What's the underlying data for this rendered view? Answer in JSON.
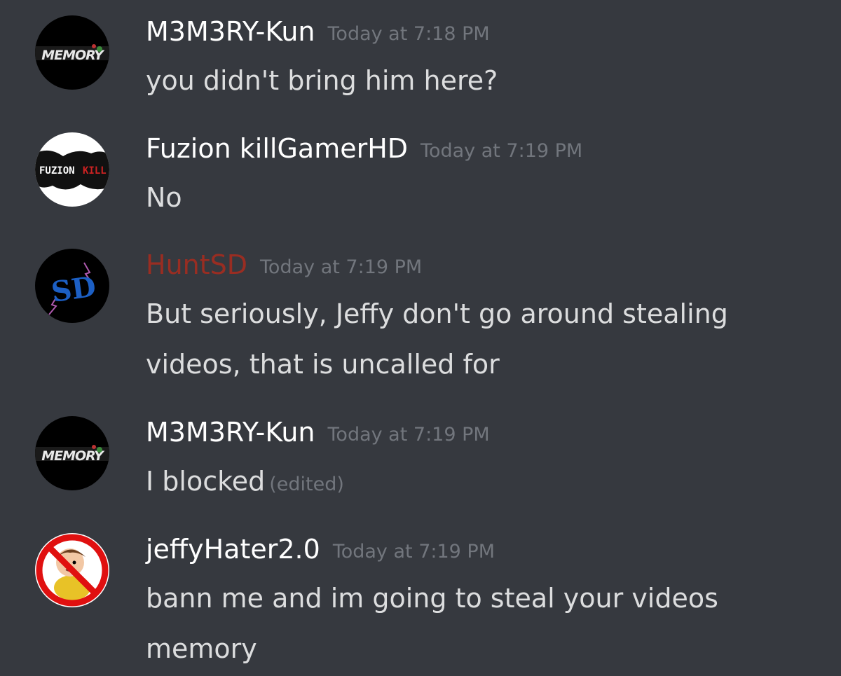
{
  "messages": [
    {
      "username": "M3M3RY-Kun",
      "timestamp": "Today at 7:18 PM",
      "lines": [
        "you didn't bring him here?"
      ],
      "avatar": {
        "icon": "memory-logo-avatar",
        "text": "MEMORY",
        "bg": "#000000"
      }
    },
    {
      "username": "Fuzion killGamerHD",
      "timestamp": "Today at 7:19 PM",
      "lines": [
        "No"
      ],
      "avatar": {
        "icon": "fuzion-kill-avatar",
        "text1": "FUZION",
        "text2": "KILL",
        "bg": "#ffffff"
      }
    },
    {
      "username": "HuntSD",
      "username_color": "#992d22",
      "timestamp": "Today at 7:19 PM",
      "lines": [
        "But seriously, Jeffy don't go around stealing",
        "videos, that is uncalled for"
      ],
      "avatar": {
        "icon": "sd-logo-avatar",
        "text": "SD",
        "bg": "#000000"
      }
    },
    {
      "username": "M3M3RY-Kun",
      "timestamp": "Today at 7:19 PM",
      "lines": [
        "I blocked"
      ],
      "edited": "(edited)",
      "avatar": {
        "icon": "memory-logo-avatar",
        "text": "MEMORY",
        "bg": "#000000"
      }
    },
    {
      "username": "jeffyHater2.0",
      "timestamp": "Today at 7:19 PM",
      "lines": [
        "bann me and im going to steal your videos",
        "memory"
      ],
      "avatar": {
        "icon": "no-jeffy-avatar",
        "bg": "#ffffff"
      }
    }
  ],
  "colors": {
    "background": "#36393f",
    "username": "#ffffff",
    "message_text": "#dcddde",
    "timestamp": "#72767d"
  }
}
